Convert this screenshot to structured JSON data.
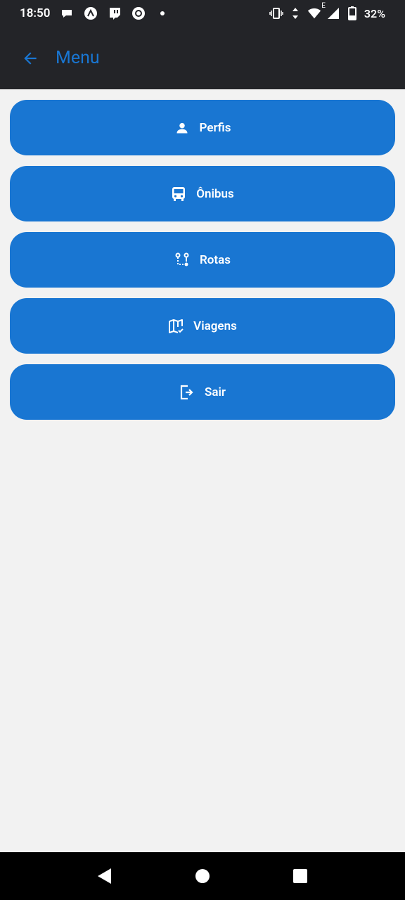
{
  "status_bar": {
    "time": "18:50",
    "battery": "32%",
    "network_label": "E",
    "left_icons": [
      "chat-bubble-icon",
      "arrow-circle-icon",
      "twitch-icon",
      "camera-circle-icon",
      "dot-icon"
    ],
    "right_icons": [
      "vibrate-icon",
      "data-arrows-icon",
      "wifi-icon",
      "signal-icon",
      "battery-icon"
    ]
  },
  "app_bar": {
    "back_icon": "arrow-left-icon",
    "title": "Menu"
  },
  "menu": {
    "items": [
      {
        "label": "Perfis",
        "icon": "person-icon"
      },
      {
        "label": "Ônibus",
        "icon": "bus-icon"
      },
      {
        "label": "Rotas",
        "icon": "route-icon"
      },
      {
        "label": "Viagens",
        "icon": "map-check-icon"
      },
      {
        "label": "Sair",
        "icon": "logout-icon"
      }
    ]
  },
  "nav_bar": {
    "buttons": [
      "back-triangle-icon",
      "home-circle-icon",
      "recents-square-icon"
    ]
  },
  "colors": {
    "accent": "#1976d2",
    "bar_background": "#232428",
    "page_background": "#f2f2f2"
  }
}
